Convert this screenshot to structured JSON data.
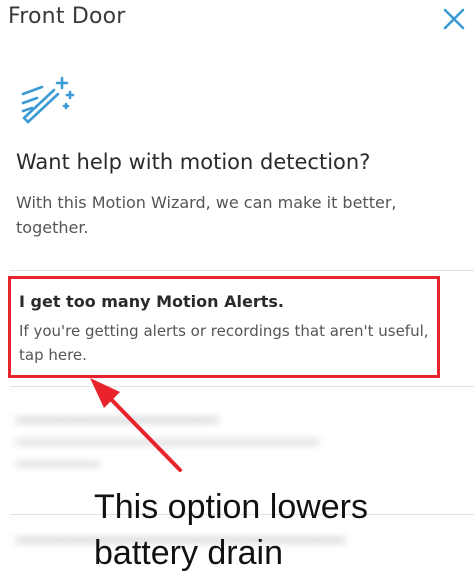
{
  "header": {
    "title": "Front Door"
  },
  "intro": {
    "heading": "Want help with motion detection?",
    "subtitle": "With this Motion Wizard, we can make it better, together."
  },
  "options": [
    {
      "title": "I get too many Motion Alerts.",
      "description": "If you're getting alerts or recordings that aren't useful, tap here."
    }
  ],
  "annotation": {
    "line1": "This option lowers",
    "line2": "battery drain"
  },
  "colors": {
    "accent": "#3a9bd5",
    "highlight": "#e8232b"
  }
}
